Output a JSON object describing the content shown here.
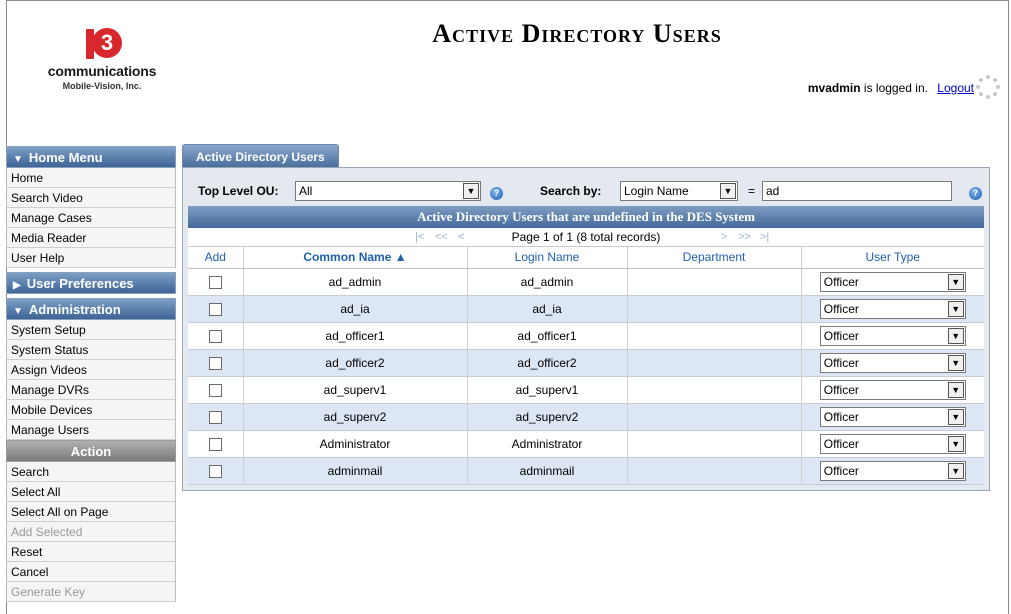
{
  "header": {
    "logo_mark": "3",
    "logo_text": "communications",
    "logo_sub": "Mobile-Vision, Inc.",
    "title": "Active Directory Users",
    "user": "mvadmin",
    "logged_in_text": "is logged in.",
    "logout_label": "Logout"
  },
  "sidebar": {
    "home_menu": {
      "label": "Home Menu",
      "items": [
        "Home",
        "Search Video",
        "Manage Cases",
        "Media Reader",
        "User Help"
      ]
    },
    "user_prefs": {
      "label": "User Preferences"
    },
    "administration": {
      "label": "Administration",
      "items": [
        "System Setup",
        "System Status",
        "Assign Videos",
        "Manage DVRs",
        "Mobile Devices",
        "Manage Users"
      ]
    },
    "action": {
      "label": "Action",
      "items": [
        {
          "label": "Search",
          "enabled": true
        },
        {
          "label": "Select All",
          "enabled": true
        },
        {
          "label": "Select All on Page",
          "enabled": true
        },
        {
          "label": "Add Selected",
          "enabled": false
        },
        {
          "label": "Reset",
          "enabled": true
        },
        {
          "label": "Cancel",
          "enabled": true
        },
        {
          "label": "Generate Key",
          "enabled": false
        }
      ]
    }
  },
  "main": {
    "tab_label": "Active Directory Users",
    "filters": {
      "top_ou_label": "Top Level OU:",
      "top_ou_value": "All",
      "search_by_label": "Search by:",
      "search_by_value": "Login Name",
      "equals": "=",
      "search_value": "ad"
    },
    "table": {
      "title": "Active Directory Users that are undefined in the DES System",
      "pager_text": "Page 1 of 1 (8 total records)",
      "headers": {
        "add": "Add",
        "common_name": "Common Name ▲",
        "login_name": "Login Name",
        "department": "Department",
        "user_type": "User Type"
      },
      "rows": [
        {
          "common_name": "ad_admin",
          "login_name": "ad_admin",
          "department": "",
          "user_type": "Officer"
        },
        {
          "common_name": "ad_ia",
          "login_name": "ad_ia",
          "department": "",
          "user_type": "Officer"
        },
        {
          "common_name": "ad_officer1",
          "login_name": "ad_officer1",
          "department": "",
          "user_type": "Officer"
        },
        {
          "common_name": "ad_officer2",
          "login_name": "ad_officer2",
          "department": "",
          "user_type": "Officer"
        },
        {
          "common_name": "ad_superv1",
          "login_name": "ad_superv1",
          "department": "",
          "user_type": "Officer"
        },
        {
          "common_name": "ad_superv2",
          "login_name": "ad_superv2",
          "department": "",
          "user_type": "Officer"
        },
        {
          "common_name": "Administrator",
          "login_name": "Administrator",
          "department": "",
          "user_type": "Officer"
        },
        {
          "common_name": "adminmail",
          "login_name": "adminmail",
          "department": "",
          "user_type": "Officer"
        }
      ]
    }
  },
  "colors": {
    "menu_header": "#3d6496",
    "row_alt": "#dde6f4",
    "link": "#0000cc",
    "header_text": "#1f5fb0"
  }
}
